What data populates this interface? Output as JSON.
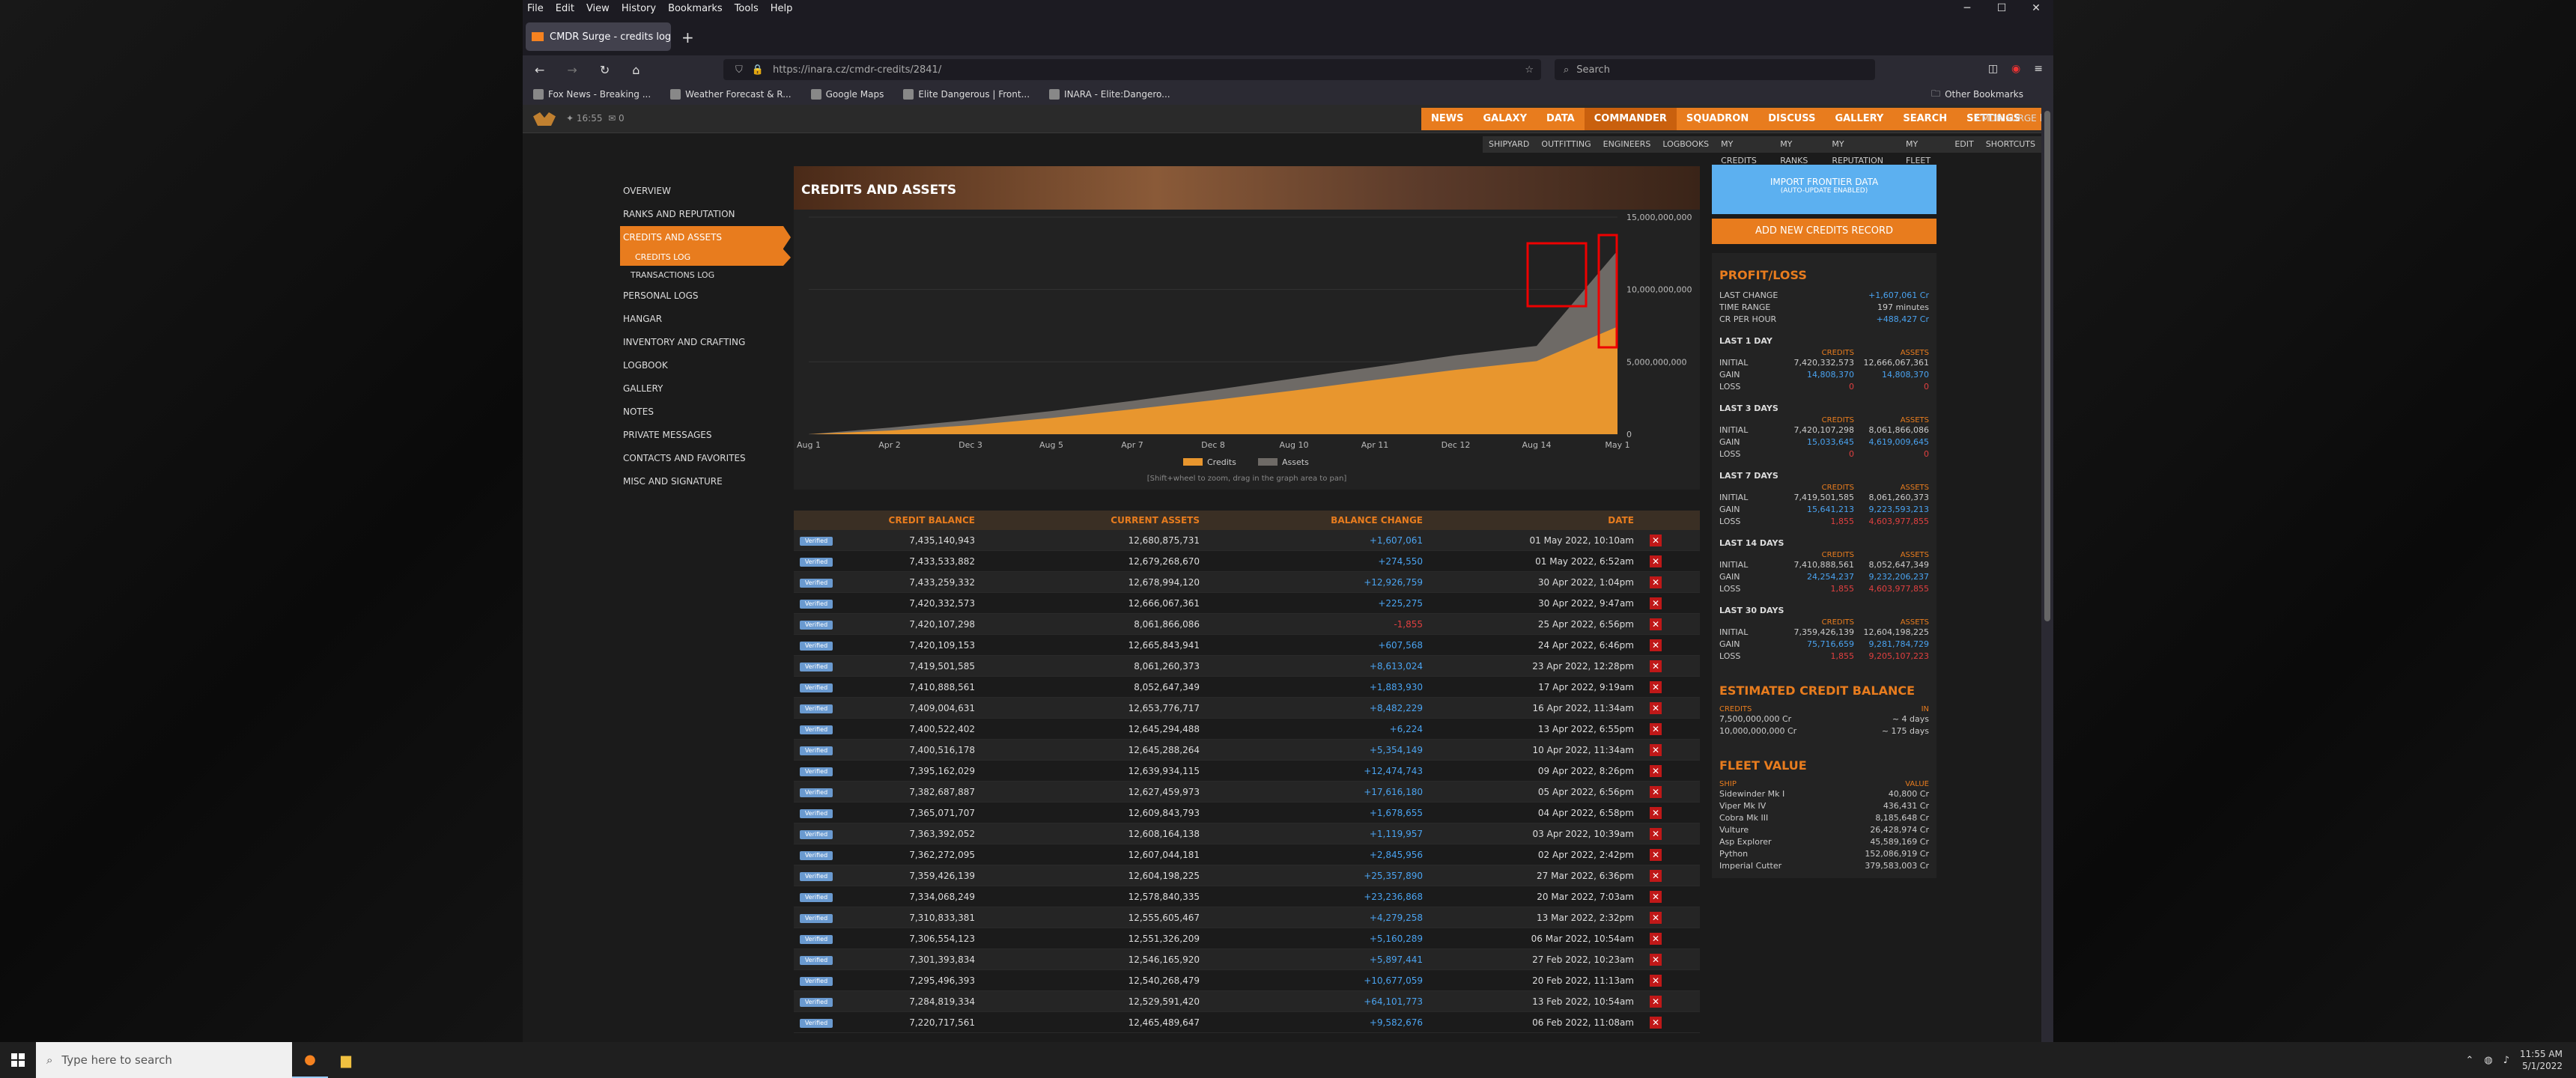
{
  "browser": {
    "menu": [
      "File",
      "Edit",
      "View",
      "History",
      "Bookmarks",
      "Tools",
      "Help"
    ],
    "tab_title": "CMDR Surge - credits log | INARA",
    "url": "https://inara.cz/cmdr-credits/2841/",
    "search_placeholder": "Search",
    "bookmarks": [
      "Fox News - Breaking ...",
      "Weather Forecast & R...",
      "Google Maps",
      "Elite Dangerous | Front...",
      "INARA - Elite:Dangero..."
    ],
    "other_bookmarks": "Other Bookmarks"
  },
  "inara": {
    "time": "16:55",
    "notif": "0",
    "nav": [
      "NEWS",
      "GALAXY",
      "DATA",
      "COMMANDER",
      "SQUADRON",
      "DISCUSS",
      "GALLERY",
      "SEARCH",
      "SETTINGS",
      "LOGOUT"
    ],
    "cmdr": "CMDR SURGE",
    "subnav": [
      "SHIPYARD",
      "OUTFITTING",
      "ENGINEERS",
      "LOGBOOKS",
      "MY CREDITS",
      "MY RANKS",
      "MY REPUTATION",
      "MY FLEET",
      "EDIT",
      "SHORTCUTS"
    ]
  },
  "sidebar": {
    "items": [
      "OVERVIEW",
      "RANKS AND REPUTATION",
      "CREDITS AND ASSETS",
      "CREDITS LOG",
      "TRANSACTIONS LOG",
      "PERSONAL LOGS",
      "HANGAR",
      "INVENTORY AND CRAFTING",
      "LOGBOOK",
      "GALLERY",
      "NOTES",
      "PRIVATE MESSAGES",
      "CONTACTS AND FAVORITES",
      "MISC AND SIGNATURE"
    ]
  },
  "section_title": "CREDITS AND ASSETS",
  "chart_data": {
    "type": "area",
    "categories": [
      "Aug 1",
      "Apr 2",
      "Dec 3",
      "Aug 5",
      "Apr 7",
      "Dec 8",
      "Aug 10",
      "Apr 11",
      "Dec 12",
      "Aug 14",
      "May 1"
    ],
    "series": [
      {
        "name": "Credits",
        "color": "#e8962e",
        "values": [
          0,
          0.25,
          0.62,
          1.12,
          1.72,
          2.35,
          3.02,
          3.75,
          4.45,
          5.05,
          7.43
        ]
      },
      {
        "name": "Assets",
        "color": "#6e6a66",
        "values": [
          0,
          0.45,
          0.98,
          1.6,
          2.3,
          3.05,
          3.85,
          4.65,
          5.45,
          6.1,
          12.68
        ]
      }
    ],
    "yticks": [
      "0",
      "5,000,000,000",
      "10,000,000,000",
      "15,000,000,000"
    ],
    "ylim": [
      0,
      15
    ],
    "hint": "[Shift+wheel to zoom, drag in the graph area to pan]"
  },
  "table": {
    "headers": [
      "CREDIT BALANCE",
      "CURRENT ASSETS",
      "BALANCE CHANGE",
      "DATE"
    ],
    "badge": "Verified",
    "rows": [
      [
        "7,435,140,943",
        "12,680,875,731",
        "+1,607,061",
        "01 May 2022, 10:10am"
      ],
      [
        "7,433,533,882",
        "12,679,268,670",
        "+274,550",
        "01 May 2022, 6:52am"
      ],
      [
        "7,433,259,332",
        "12,678,994,120",
        "+12,926,759",
        "30 Apr 2022, 1:04pm"
      ],
      [
        "7,420,332,573",
        "12,666,067,361",
        "+225,275",
        "30 Apr 2022, 9:47am"
      ],
      [
        "7,420,107,298",
        "8,061,866,086",
        "-1,855",
        "25 Apr 2022, 6:56pm"
      ],
      [
        "7,420,109,153",
        "12,665,843,941",
        "+607,568",
        "24 Apr 2022, 6:46pm"
      ],
      [
        "7,419,501,585",
        "8,061,260,373",
        "+8,613,024",
        "23 Apr 2022, 12:28pm"
      ],
      [
        "7,410,888,561",
        "8,052,647,349",
        "+1,883,930",
        "17 Apr 2022, 9:19am"
      ],
      [
        "7,409,004,631",
        "12,653,776,717",
        "+8,482,229",
        "16 Apr 2022, 11:34am"
      ],
      [
        "7,400,522,402",
        "12,645,294,488",
        "+6,224",
        "13 Apr 2022, 6:55pm"
      ],
      [
        "7,400,516,178",
        "12,645,288,264",
        "+5,354,149",
        "10 Apr 2022, 11:34am"
      ],
      [
        "7,395,162,029",
        "12,639,934,115",
        "+12,474,743",
        "09 Apr 2022, 8:26pm"
      ],
      [
        "7,382,687,887",
        "12,627,459,973",
        "+17,616,180",
        "05 Apr 2022, 6:56pm"
      ],
      [
        "7,365,071,707",
        "12,609,843,793",
        "+1,678,655",
        "04 Apr 2022, 6:58pm"
      ],
      [
        "7,363,392,052",
        "12,608,164,138",
        "+1,119,957",
        "03 Apr 2022, 10:39am"
      ],
      [
        "7,362,272,095",
        "12,607,044,181",
        "+2,845,956",
        "02 Apr 2022, 2:42pm"
      ],
      [
        "7,359,426,139",
        "12,604,198,225",
        "+25,357,890",
        "27 Mar 2022, 6:36pm"
      ],
      [
        "7,334,068,249",
        "12,578,840,335",
        "+23,236,868",
        "20 Mar 2022, 7:03am"
      ],
      [
        "7,310,833,381",
        "12,555,605,467",
        "+4,279,258",
        "13 Mar 2022, 2:32pm"
      ],
      [
        "7,306,554,123",
        "12,551,326,209",
        "+5,160,289",
        "06 Mar 2022, 10:54am"
      ],
      [
        "7,301,393,834",
        "12,546,165,920",
        "+5,897,441",
        "27 Feb 2022, 10:23am"
      ],
      [
        "7,295,496,393",
        "12,540,268,479",
        "+10,677,059",
        "20 Feb 2022, 11:13am"
      ],
      [
        "7,284,819,334",
        "12,529,591,420",
        "+64,101,773",
        "13 Feb 2022, 10:54am"
      ],
      [
        "7,220,717,561",
        "12,465,489,647",
        "+9,582,676",
        "06 Feb 2022, 11:08am"
      ]
    ]
  },
  "right": {
    "import_label": "IMPORT FRONTIER DATA",
    "import_sub": "(AUTO-UPDATE ENABLED)",
    "add_label": "ADD NEW CREDITS RECORD",
    "pl_title": "PROFIT/LOSS",
    "last_change": [
      "LAST CHANGE",
      "+1,607,061 Cr"
    ],
    "time_range": [
      "TIME RANGE",
      "197 minutes"
    ],
    "cr_per_hour": [
      "CR PER HOUR",
      "+488,427 Cr"
    ],
    "periods": [
      {
        "name": "LAST 1 DAY",
        "initial": [
          "7,420,332,573",
          "12,666,067,361"
        ],
        "gain": [
          "14,808,370",
          "14,808,370"
        ],
        "loss": [
          "0",
          "0"
        ]
      },
      {
        "name": "LAST 3 DAYS",
        "initial": [
          "7,420,107,298",
          "8,061,866,086"
        ],
        "gain": [
          "15,033,645",
          "4,619,009,645"
        ],
        "loss": [
          "0",
          "0"
        ]
      },
      {
        "name": "LAST 7 DAYS",
        "initial": [
          "7,419,501,585",
          "8,061,260,373"
        ],
        "gain": [
          "15,641,213",
          "9,223,593,213"
        ],
        "loss": [
          "1,855",
          "4,603,977,855"
        ]
      },
      {
        "name": "LAST 14 DAYS",
        "initial": [
          "7,410,888,561",
          "8,052,647,349"
        ],
        "gain": [
          "24,254,237",
          "9,232,206,237"
        ],
        "loss": [
          "1,855",
          "4,603,977,855"
        ]
      },
      {
        "name": "LAST 30 DAYS",
        "initial": [
          "7,359,426,139",
          "12,604,198,225"
        ],
        "gain": [
          "75,716,659",
          "9,281,784,729"
        ],
        "loss": [
          "1,855",
          "9,205,107,223"
        ]
      }
    ],
    "est_title": "ESTIMATED CREDIT BALANCE",
    "est_cols": [
      "CREDITS",
      "IN"
    ],
    "est": [
      [
        "7,500,000,000 Cr",
        "~ 4 days"
      ],
      [
        "10,000,000,000 Cr",
        "~ 175 days"
      ]
    ],
    "fleet_title": "FLEET VALUE",
    "fleet_cols": [
      "SHIP",
      "VALUE"
    ],
    "fleet": [
      [
        "Sidewinder Mk I",
        "40,800 Cr"
      ],
      [
        "Viper Mk IV",
        "436,431 Cr"
      ],
      [
        "Cobra Mk III",
        "8,185,648 Cr"
      ],
      [
        "Vulture",
        "26,428,974 Cr"
      ],
      [
        "Asp Explorer",
        "45,589,169 Cr"
      ],
      [
        "Python",
        "152,086,919 Cr"
      ],
      [
        "Imperial Cutter",
        "379,583,003 Cr"
      ]
    ]
  },
  "taskbar": {
    "search": "Type here to search",
    "time": "11:55 AM",
    "date": "5/1/2022"
  }
}
